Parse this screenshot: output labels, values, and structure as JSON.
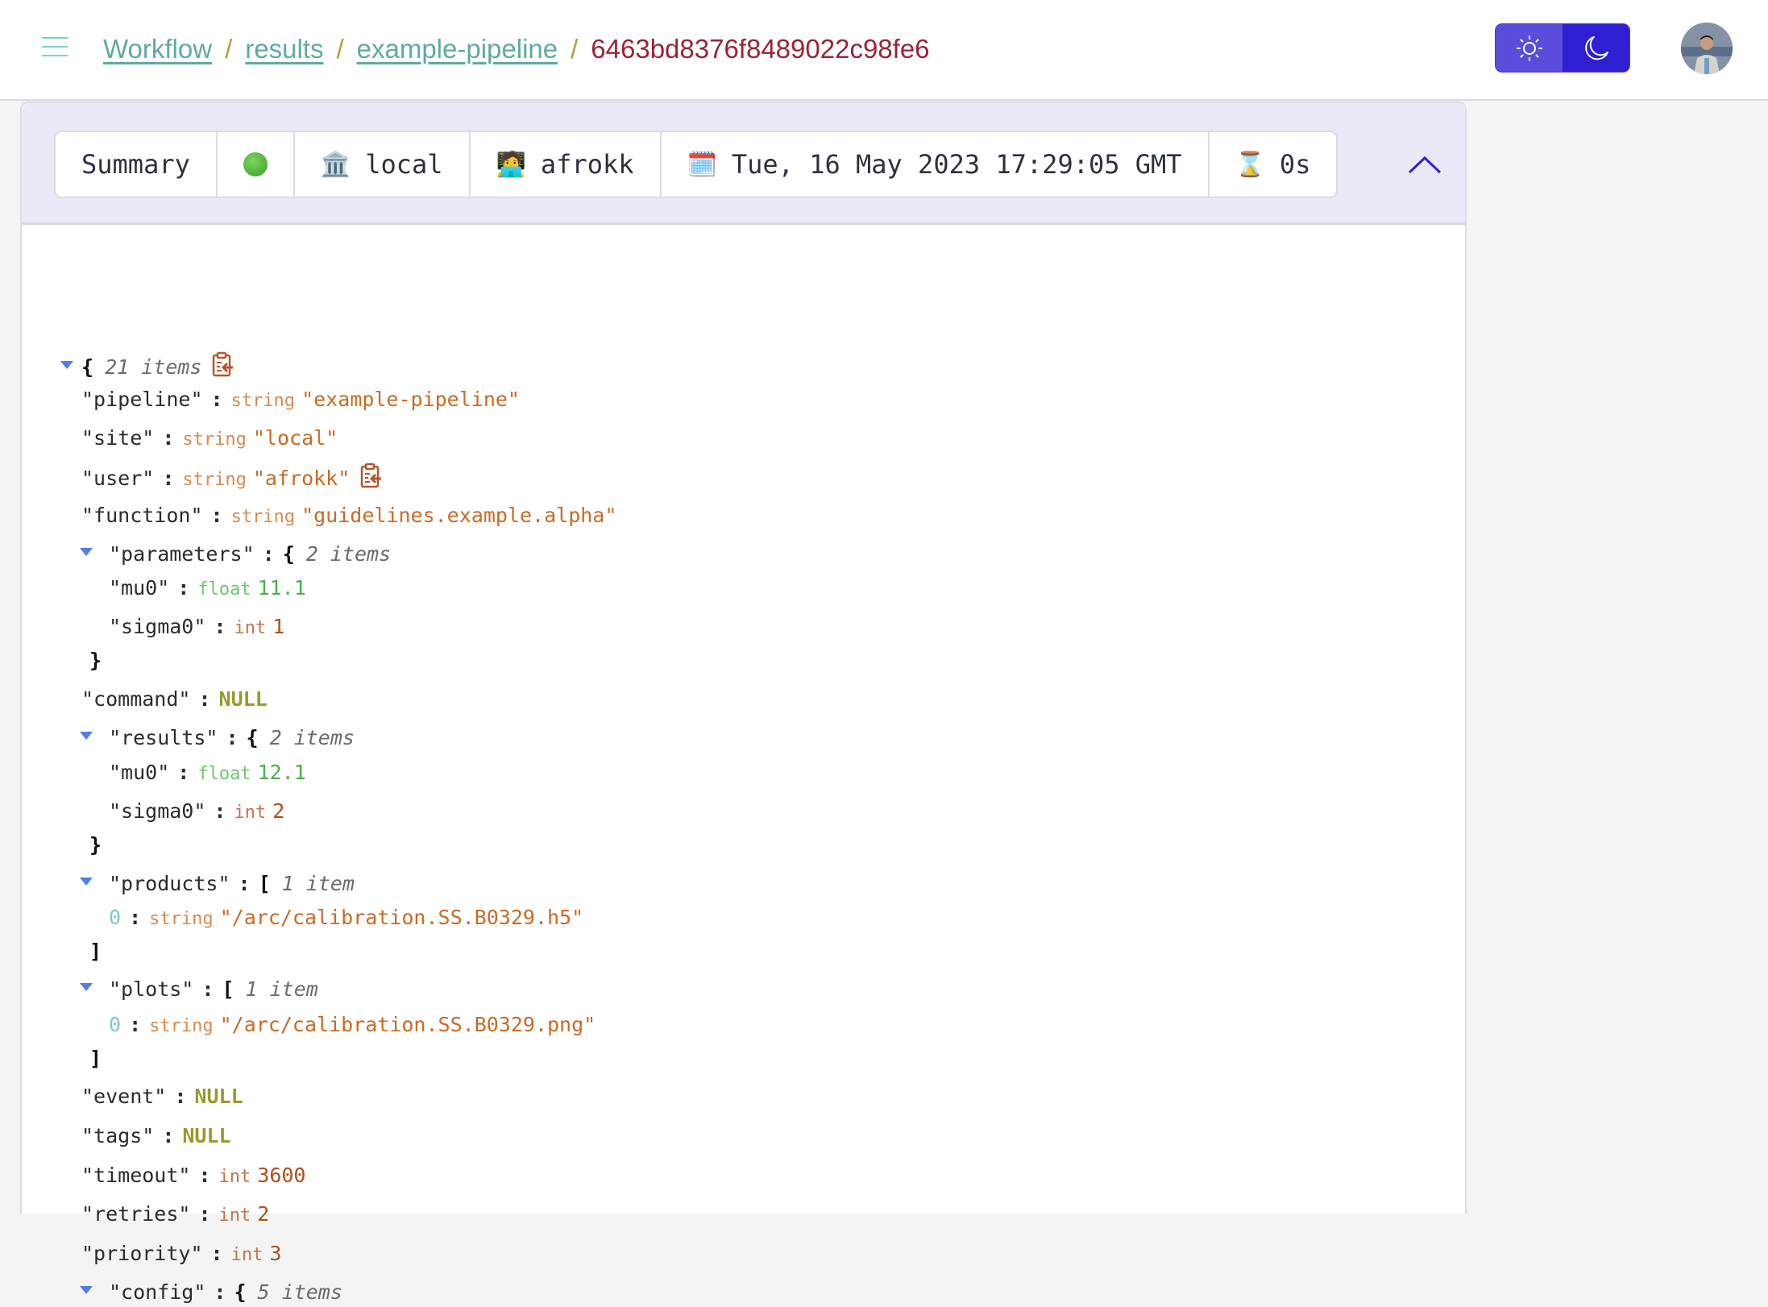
{
  "header": {
    "breadcrumb": [
      {
        "label": "Workflow"
      },
      {
        "label": "results"
      },
      {
        "label": "example-pipeline"
      }
    ],
    "separator": "/",
    "current": "6463bd8376f8489022c98fe6",
    "theme_options": [
      "light",
      "dark"
    ],
    "avatar_alt": "user avatar"
  },
  "summary": {
    "label": "Summary",
    "status": "success",
    "site_icon": "🏛️",
    "site": "local",
    "user_icon": "🧑‍💻",
    "user": "afrokk",
    "date_icon": "🗓️",
    "date": "Tue, 16 May 2023 17:29:05 GMT",
    "duration_icon": "⌛",
    "duration": "0s"
  },
  "tree": {
    "root_open": "{",
    "root_count": "21 items",
    "rows": [
      {
        "key": "\"pipeline\"",
        "type": "string",
        "value": "\"example-pipeline\""
      },
      {
        "key": "\"site\"",
        "type": "string",
        "value": "\"local\""
      },
      {
        "key": "\"user\"",
        "type": "string",
        "value": "\"afrokk\""
      },
      {
        "key": "\"function\"",
        "type": "string",
        "value": "\"guidelines.example.alpha\""
      },
      {
        "key": "\"parameters\"",
        "open": "{",
        "count": "2 items"
      },
      {
        "key": "\"mu0\"",
        "type": "float",
        "value": "11.1"
      },
      {
        "key": "\"sigma0\"",
        "type": "int",
        "value": "1"
      },
      {
        "close": "}"
      },
      {
        "key": "\"command\"",
        "value": "NULL"
      },
      {
        "key": "\"results\"",
        "open": "{",
        "count": "2 items"
      },
      {
        "key": "\"mu0\"",
        "type": "float",
        "value": "12.1"
      },
      {
        "key": "\"sigma0\"",
        "type": "int",
        "value": "2"
      },
      {
        "close": "}"
      },
      {
        "key": "\"products\"",
        "open": "[",
        "count": "1 item"
      },
      {
        "key": "0",
        "type": "string",
        "value": "\"/arc/calibration.SS.B0329.h5\""
      },
      {
        "close": "]"
      },
      {
        "key": "\"plots\"",
        "open": "[",
        "count": "1 item"
      },
      {
        "key": "0",
        "type": "string",
        "value": "\"/arc/calibration.SS.B0329.png\""
      },
      {
        "close": "]"
      },
      {
        "key": "\"event\"",
        "value": "NULL"
      },
      {
        "key": "\"tags\"",
        "value": "NULL"
      },
      {
        "key": "\"timeout\"",
        "type": "int",
        "value": "3600"
      },
      {
        "key": "\"retries\"",
        "type": "int",
        "value": "2"
      },
      {
        "key": "\"priority\"",
        "type": "int",
        "value": "3"
      },
      {
        "key": "\"config\"",
        "open": "{",
        "count": "5 items"
      }
    ]
  },
  "colors": {
    "accent": "#3320d0",
    "link": "#5fa9a5",
    "current_crumb": "#9b2335",
    "panel_header_bg": "#ebe8f8"
  }
}
